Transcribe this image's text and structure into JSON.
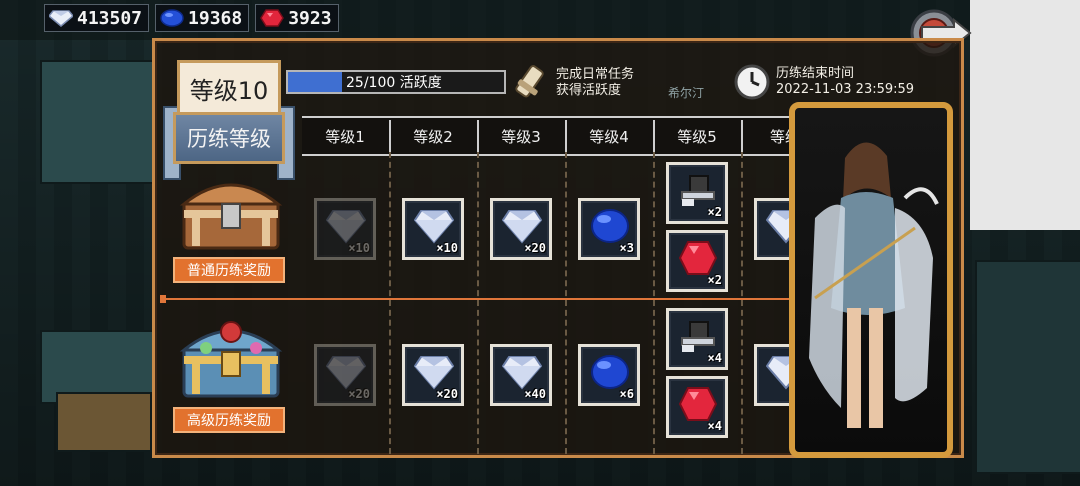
{
  "currencies": [
    {
      "icon": "white-diamond-icon",
      "value": "413507"
    },
    {
      "icon": "blue-sapphire-icon",
      "value": "19368"
    },
    {
      "icon": "red-ruby-icon",
      "value": "3923"
    }
  ],
  "header": {
    "level_badge": "等级10",
    "level_title": "历练等级",
    "progress_text": "25/100 活跃度",
    "progress_fraction": 0.25,
    "task_line1": "完成日常任务",
    "task_line2": "获得活跃度",
    "end_label": "历练结束时间",
    "end_time": "2022-11-03 23:59:59"
  },
  "levels": [
    "等级1",
    "等级2",
    "等级3",
    "等级4",
    "等级5",
    "等级"
  ],
  "normal_reward": {
    "label": "普通历练奖励",
    "items": [
      {
        "gem": "white-diamond",
        "count": "×10",
        "dim": true
      },
      {
        "gem": "white-diamond",
        "count": "×10"
      },
      {
        "gem": "white-diamond",
        "count": "×20"
      },
      {
        "gem": "blue-sapphire",
        "count": "×3"
      },
      {
        "gem": "silver-hat",
        "count": "×2"
      },
      {
        "gem": "red-ruby",
        "count": "×2"
      },
      {
        "gem": "white-diamond",
        "count": ""
      }
    ]
  },
  "advanced_reward": {
    "label": "高级历练奖励",
    "items": [
      {
        "gem": "white-diamond",
        "count": "×20",
        "dim": true
      },
      {
        "gem": "white-diamond",
        "count": "×20"
      },
      {
        "gem": "white-diamond",
        "count": "×40"
      },
      {
        "gem": "blue-sapphire",
        "count": "×6"
      },
      {
        "gem": "silver-hat",
        "count": "×4"
      },
      {
        "gem": "red-ruby",
        "count": "×4"
      },
      {
        "gem": "white-diamond",
        "count": ""
      }
    ]
  },
  "colors": {
    "accent": "#e2722e",
    "frame": "#c98a4a",
    "progress": "#3f6fd1"
  }
}
